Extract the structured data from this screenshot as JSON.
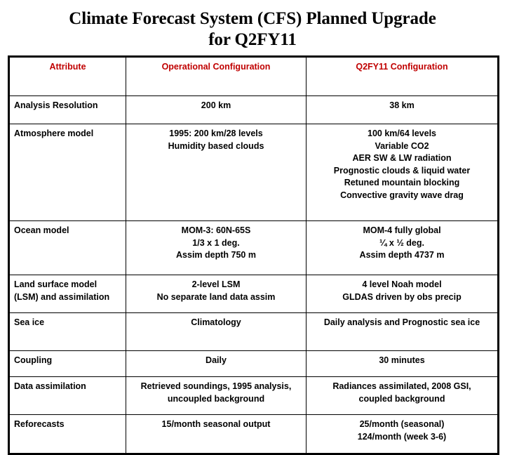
{
  "slide": {
    "title_lines": [
      "Climate Forecast System (CFS) Planned Upgrade",
      "for Q2FY11"
    ],
    "accent_color": "#C00000",
    "border_color": "#000000",
    "background_color": "#FFFFFF"
  },
  "table": {
    "headers": [
      "Attribute",
      "Operational Configuration",
      "Q2FY11 Configuration"
    ],
    "rows": [
      {
        "attribute": [
          "Analysis Resolution"
        ],
        "operational": [
          "200 km"
        ],
        "q2fy11": [
          "38 km"
        ]
      },
      {
        "attribute": [
          "Atmosphere model"
        ],
        "operational": [
          "1995: 200 km/28 levels",
          "Humidity based clouds"
        ],
        "q2fy11": [
          "100 km/64 levels",
          "Variable CO2",
          "AER SW & LW radiation",
          "Prognostic clouds & liquid water",
          "Retuned mountain blocking",
          "Convective gravity wave drag"
        ]
      },
      {
        "attribute": [
          "Ocean model"
        ],
        "operational": [
          "MOM-3: 60N-65S",
          "1/3 x 1 deg.",
          "Assim depth 750 m"
        ],
        "q2fy11": [
          "MOM-4 fully global",
          "¼ x ½ deg.",
          "Assim depth 4737 m"
        ]
      },
      {
        "attribute": [
          "Land surface model",
          "(LSM) and assimilation"
        ],
        "operational": [
          "2-level LSM",
          "No separate land data assim"
        ],
        "q2fy11": [
          "4 level Noah model",
          "GLDAS driven by obs precip"
        ]
      },
      {
        "attribute": [
          "Sea ice"
        ],
        "operational": [
          "Climatology"
        ],
        "q2fy11": [
          "Daily analysis and Prognostic sea ice"
        ]
      },
      {
        "attribute": [
          "Coupling"
        ],
        "operational": [
          "Daily"
        ],
        "q2fy11": [
          "30 minutes"
        ]
      },
      {
        "attribute": [
          "Data assimilation"
        ],
        "operational": [
          "Retrieved soundings, 1995 analysis,",
          "uncoupled background"
        ],
        "q2fy11": [
          "Radiances assimilated, 2008 GSI,",
          "coupled background"
        ]
      },
      {
        "attribute": [
          "Reforecasts"
        ],
        "operational": [
          "15/month seasonal output"
        ],
        "q2fy11": [
          "25/month (seasonal)",
          "124/month (week 3-6)"
        ]
      }
    ]
  }
}
